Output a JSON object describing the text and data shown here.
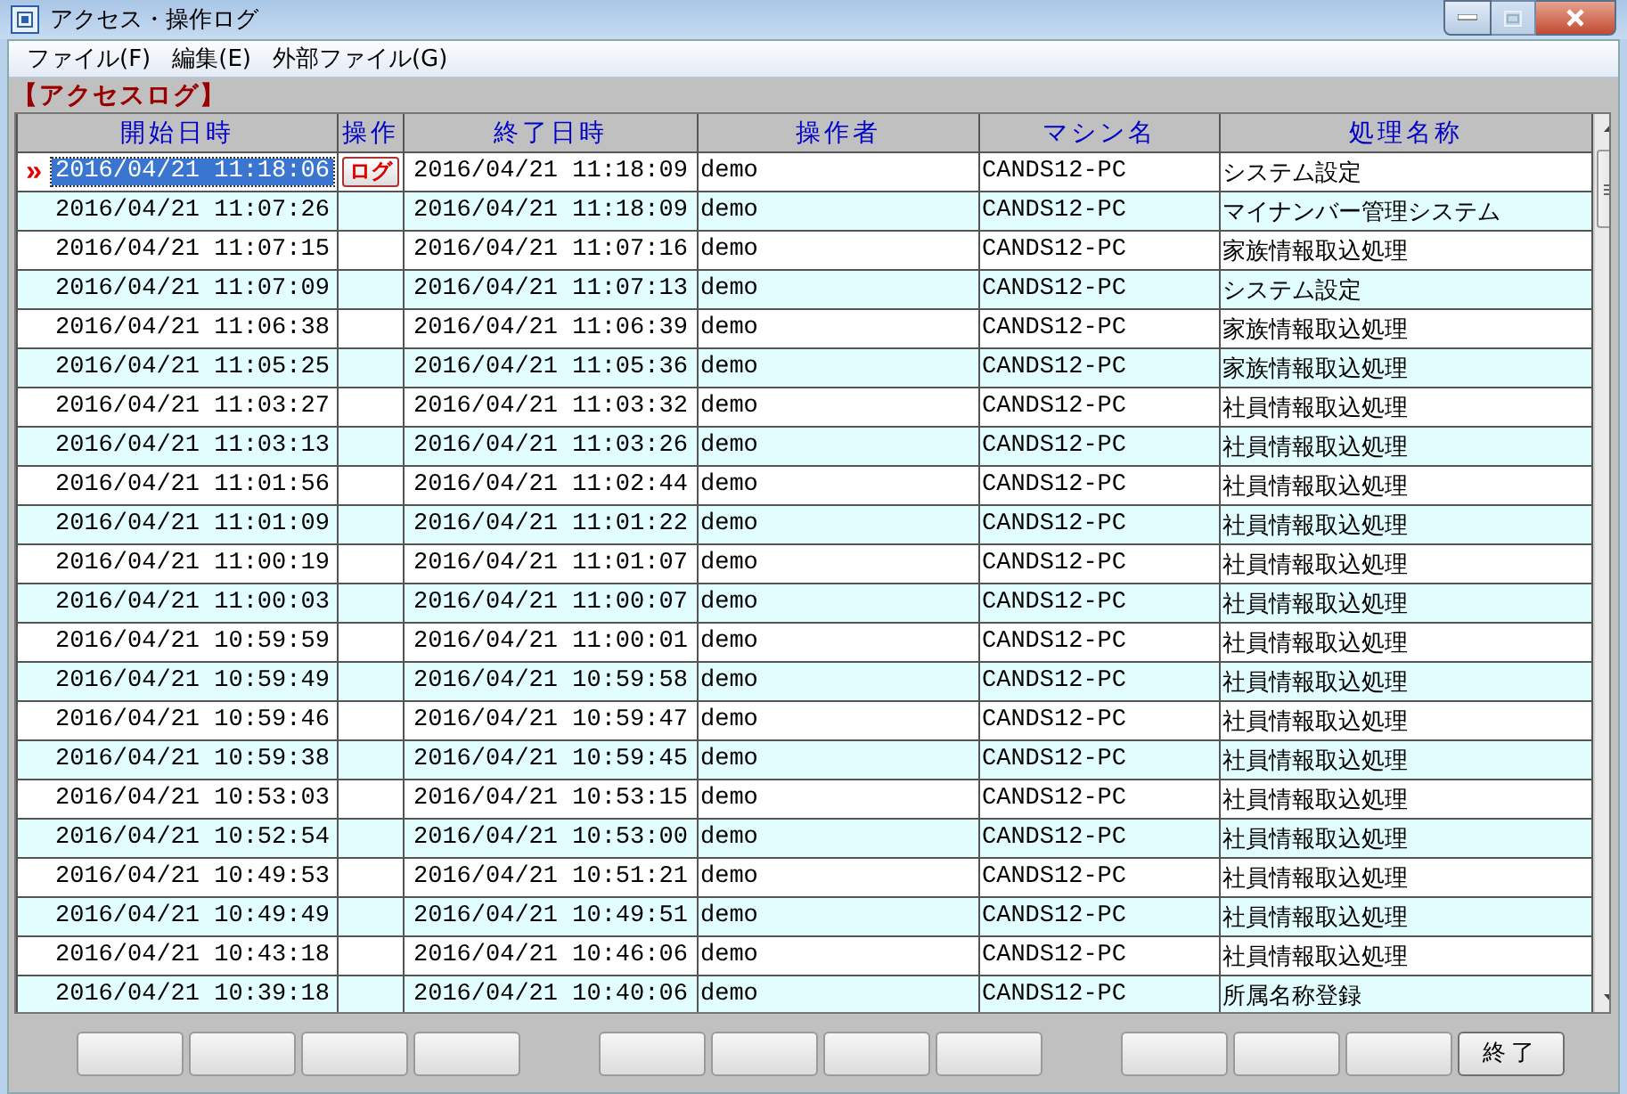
{
  "window": {
    "title": "アクセス・操作ログ"
  },
  "menu": [
    {
      "label": "ファイル(F)"
    },
    {
      "label": "編集(E)"
    },
    {
      "label": "外部ファイル(G)"
    }
  ],
  "section_title": "【アクセスログ】",
  "table": {
    "columns": [
      "開始日時",
      "操作",
      "終了日時",
      "操作者",
      "マシン名",
      "処理名称"
    ],
    "rows": [
      {
        "selected": true,
        "marker": "»",
        "start": "2016/04/21 11:18:06",
        "action": "ログ",
        "end": "2016/04/21 11:18:09",
        "operator": "demo",
        "machine": "CANDS12-PC",
        "process": "システム設定"
      },
      {
        "selected": false,
        "start": "2016/04/21 11:07:26",
        "end": "2016/04/21 11:18:09",
        "operator": "demo",
        "machine": "CANDS12-PC",
        "process": "マイナンバー管理システム"
      },
      {
        "selected": false,
        "start": "2016/04/21 11:07:15",
        "end": "2016/04/21 11:07:16",
        "operator": "demo",
        "machine": "CANDS12-PC",
        "process": "家族情報取込処理"
      },
      {
        "selected": false,
        "start": "2016/04/21 11:07:09",
        "end": "2016/04/21 11:07:13",
        "operator": "demo",
        "machine": "CANDS12-PC",
        "process": "システム設定"
      },
      {
        "selected": false,
        "start": "2016/04/21 11:06:38",
        "end": "2016/04/21 11:06:39",
        "operator": "demo",
        "machine": "CANDS12-PC",
        "process": "家族情報取込処理"
      },
      {
        "selected": false,
        "start": "2016/04/21 11:05:25",
        "end": "2016/04/21 11:05:36",
        "operator": "demo",
        "machine": "CANDS12-PC",
        "process": "家族情報取込処理"
      },
      {
        "selected": false,
        "start": "2016/04/21 11:03:27",
        "end": "2016/04/21 11:03:32",
        "operator": "demo",
        "machine": "CANDS12-PC",
        "process": "社員情報取込処理"
      },
      {
        "selected": false,
        "start": "2016/04/21 11:03:13",
        "end": "2016/04/21 11:03:26",
        "operator": "demo",
        "machine": "CANDS12-PC",
        "process": "社員情報取込処理"
      },
      {
        "selected": false,
        "start": "2016/04/21 11:01:56",
        "end": "2016/04/21 11:02:44",
        "operator": "demo",
        "machine": "CANDS12-PC",
        "process": "社員情報取込処理"
      },
      {
        "selected": false,
        "start": "2016/04/21 11:01:09",
        "end": "2016/04/21 11:01:22",
        "operator": "demo",
        "machine": "CANDS12-PC",
        "process": "社員情報取込処理"
      },
      {
        "selected": false,
        "start": "2016/04/21 11:00:19",
        "end": "2016/04/21 11:01:07",
        "operator": "demo",
        "machine": "CANDS12-PC",
        "process": "社員情報取込処理"
      },
      {
        "selected": false,
        "start": "2016/04/21 11:00:03",
        "end": "2016/04/21 11:00:07",
        "operator": "demo",
        "machine": "CANDS12-PC",
        "process": "社員情報取込処理"
      },
      {
        "selected": false,
        "start": "2016/04/21 10:59:59",
        "end": "2016/04/21 11:00:01",
        "operator": "demo",
        "machine": "CANDS12-PC",
        "process": "社員情報取込処理"
      },
      {
        "selected": false,
        "start": "2016/04/21 10:59:49",
        "end": "2016/04/21 10:59:58",
        "operator": "demo",
        "machine": "CANDS12-PC",
        "process": "社員情報取込処理"
      },
      {
        "selected": false,
        "start": "2016/04/21 10:59:46",
        "end": "2016/04/21 10:59:47",
        "operator": "demo",
        "machine": "CANDS12-PC",
        "process": "社員情報取込処理"
      },
      {
        "selected": false,
        "start": "2016/04/21 10:59:38",
        "end": "2016/04/21 10:59:45",
        "operator": "demo",
        "machine": "CANDS12-PC",
        "process": "社員情報取込処理"
      },
      {
        "selected": false,
        "start": "2016/04/21 10:53:03",
        "end": "2016/04/21 10:53:15",
        "operator": "demo",
        "machine": "CANDS12-PC",
        "process": "社員情報取込処理"
      },
      {
        "selected": false,
        "start": "2016/04/21 10:52:54",
        "end": "2016/04/21 10:53:00",
        "operator": "demo",
        "machine": "CANDS12-PC",
        "process": "社員情報取込処理"
      },
      {
        "selected": false,
        "start": "2016/04/21 10:49:53",
        "end": "2016/04/21 10:51:21",
        "operator": "demo",
        "machine": "CANDS12-PC",
        "process": "社員情報取込処理"
      },
      {
        "selected": false,
        "start": "2016/04/21 10:49:49",
        "end": "2016/04/21 10:49:51",
        "operator": "demo",
        "machine": "CANDS12-PC",
        "process": "社員情報取込処理"
      },
      {
        "selected": false,
        "start": "2016/04/21 10:43:18",
        "end": "2016/04/21 10:46:06",
        "operator": "demo",
        "machine": "CANDS12-PC",
        "process": "社員情報取込処理"
      },
      {
        "selected": false,
        "start": "2016/04/21 10:39:18",
        "end": "2016/04/21 10:40:06",
        "operator": "demo",
        "machine": "CANDS12-PC",
        "process": "所属名称登録"
      }
    ]
  },
  "buttons": [
    {
      "kind": "blank"
    },
    {
      "kind": "blank"
    },
    {
      "kind": "blank"
    },
    {
      "kind": "blank"
    },
    {
      "kind": "gap"
    },
    {
      "kind": "blank"
    },
    {
      "kind": "blank"
    },
    {
      "kind": "blank"
    },
    {
      "kind": "blank"
    },
    {
      "kind": "gap"
    },
    {
      "kind": "blank"
    },
    {
      "kind": "blank"
    },
    {
      "kind": "blank"
    },
    {
      "kind": "labeled",
      "label": "終了"
    }
  ]
}
